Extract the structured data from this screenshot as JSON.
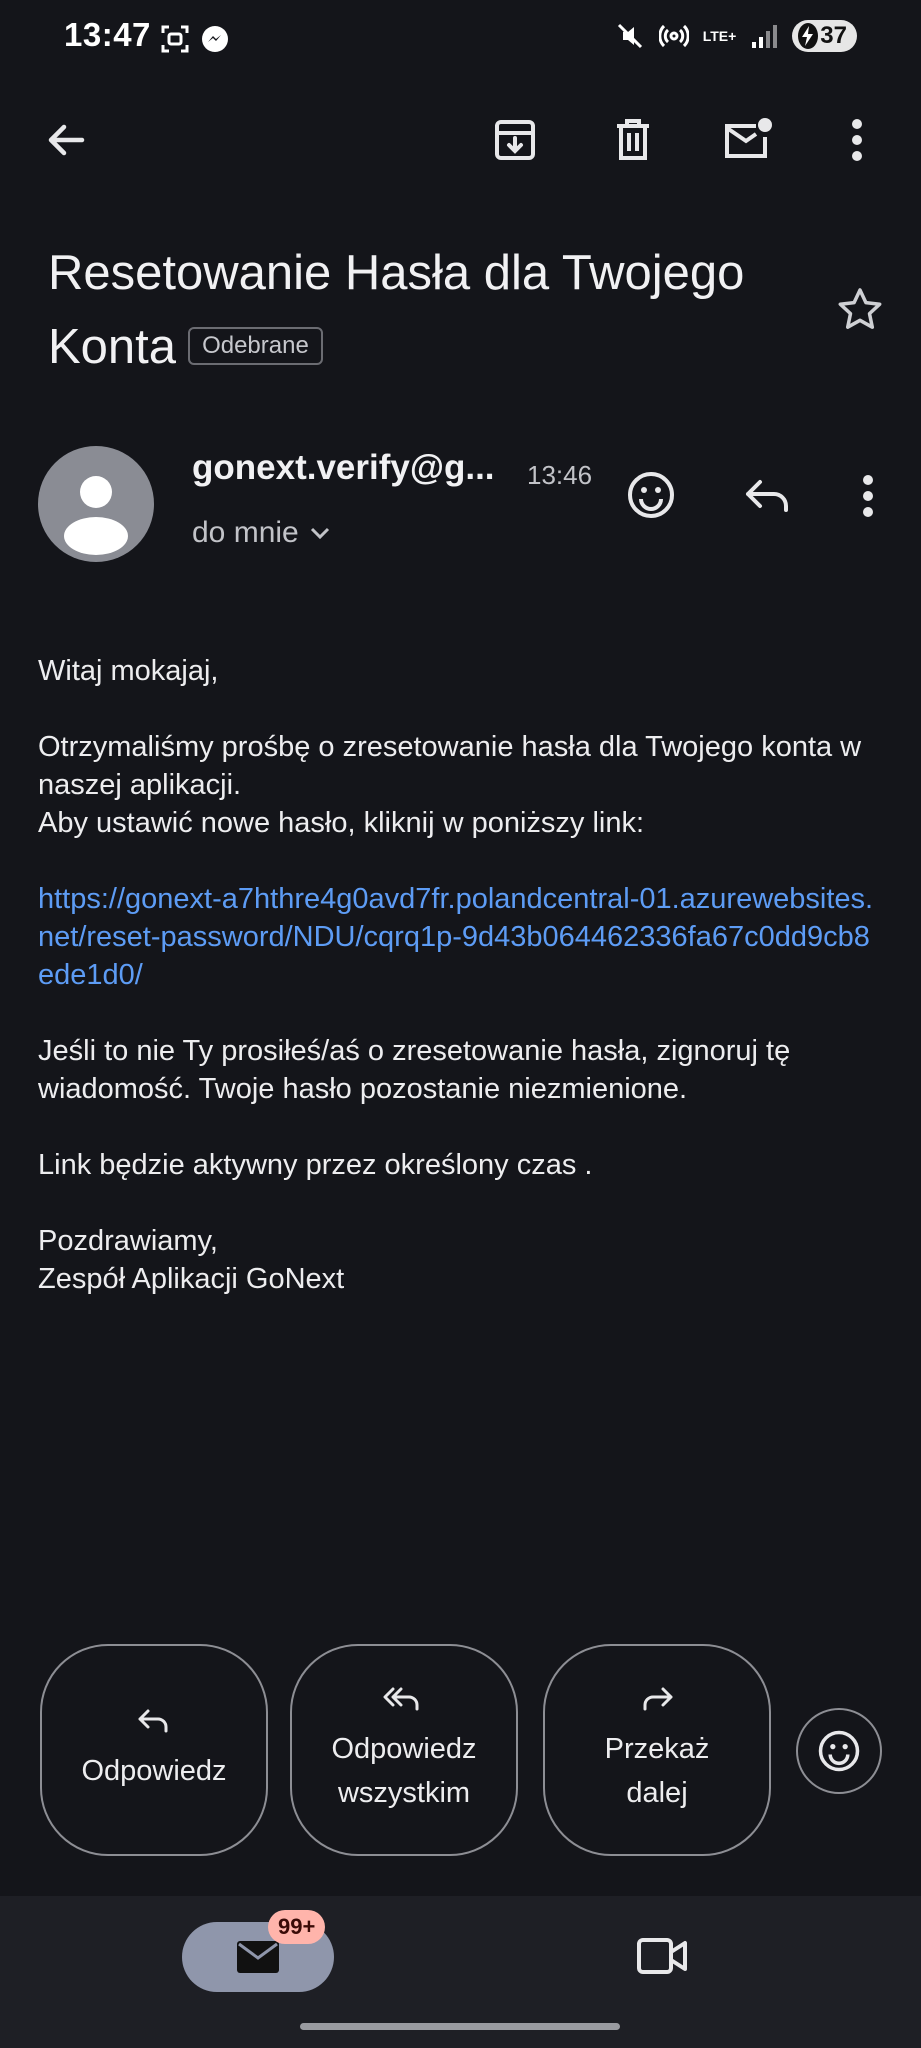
{
  "status_bar": {
    "time": "13:47",
    "battery": "37",
    "network": "LTE+"
  },
  "toolbar": {
    "back": "back-arrow",
    "archive": "archive",
    "delete": "trash",
    "mark_unread": "mail-unread",
    "more": "more-vert"
  },
  "subject": {
    "text": "Resetowanie Hasła dla Twojego Konta",
    "label": "Odebrane"
  },
  "sender": {
    "email": "gonext.verify@g...",
    "time": "13:46",
    "recipient": "do mnie"
  },
  "body": {
    "greeting": "Witaj mokajaj,",
    "para1_line1": "Otrzymaliśmy prośbę o zresetowanie hasła dla Twojego konta w naszej aplikacji.",
    "para1_line2": "Aby ustawić nowe hasło, kliknij w poniższy link:",
    "link": "https://gonext-a7hthre4g0avd7fr.polandcentral-01.azurewebsites.net/reset-password/NDU/cqrq1p-9d43b064462336fa67c0dd9cb8ede1d0/",
    "para2": "Jeśli to nie Ty prosiłeś/aś o zresetowanie hasła, zignoruj tę wiadomość. Twoje hasło pozostanie niezmienione.",
    "para3": "Link będzie aktywny przez określony czas .",
    "closing": "Pozdrawiamy,",
    "signature": "Zespół Aplikacji GoNext"
  },
  "actions": {
    "reply": "Odpowiedz",
    "reply_all_line1": "Odpowiedz",
    "reply_all_line2": "wszystkim",
    "forward_line1": "Przekaż",
    "forward_line2": "dalej"
  },
  "bottom_nav": {
    "mail_badge": "99+"
  },
  "colors": {
    "background": "#14151a",
    "link": "#5d9cf5",
    "badge": "#ffb4ab",
    "mail_pill": "#8f96ab"
  }
}
